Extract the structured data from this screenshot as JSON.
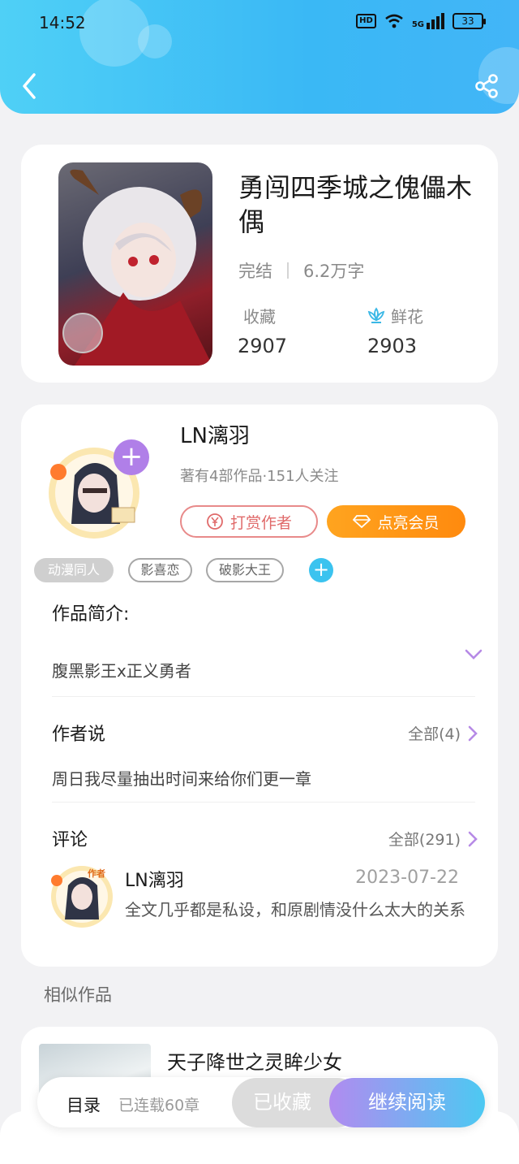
{
  "status_bar": {
    "time": "14:52",
    "hd": "HD",
    "network": "5G",
    "battery": "33"
  },
  "book": {
    "title": "勇闯四季城之傀儡木偶",
    "status": "完结",
    "word_count": "6.2万字",
    "favorites_label": "收藏",
    "favorites_count": "2907",
    "flowers_label": "鲜花",
    "flowers_count": "2903"
  },
  "author": {
    "name": "LN漓羽",
    "meta": "著有4部作品·151人关注",
    "reward_label": "打赏作者",
    "vip_label": "点亮会员",
    "tags": [
      "动漫同人",
      "影喜恋",
      "破影大王"
    ]
  },
  "intro": {
    "title": "作品简介:",
    "text": "腹黑影王x正义勇者"
  },
  "author_says": {
    "title": "作者说",
    "all_label": "全部(4)",
    "text": "周日我尽量抽出时间来给你们更一章"
  },
  "comments": {
    "title": "评论",
    "all_label": "全部(291)",
    "items": [
      {
        "user": "LN漓羽",
        "badge": "作者",
        "date": "2023-07-22",
        "text": "全文几乎都是私设，和原剧情没什么太大的关系"
      }
    ]
  },
  "similar": {
    "title": "相似作品",
    "items": [
      {
        "title": "天子降世之灵眸少女"
      }
    ]
  },
  "bottom_bar": {
    "toc_label": "目录",
    "serial_status": "已连载60章",
    "favorite_label": "已收藏",
    "read_label": "继续阅读"
  },
  "colors": {
    "header": "#3ab8f5",
    "accent_purple": "#b07fe8",
    "vip_orange": "#ff8a0e",
    "reward_red": "#e06a6a"
  }
}
